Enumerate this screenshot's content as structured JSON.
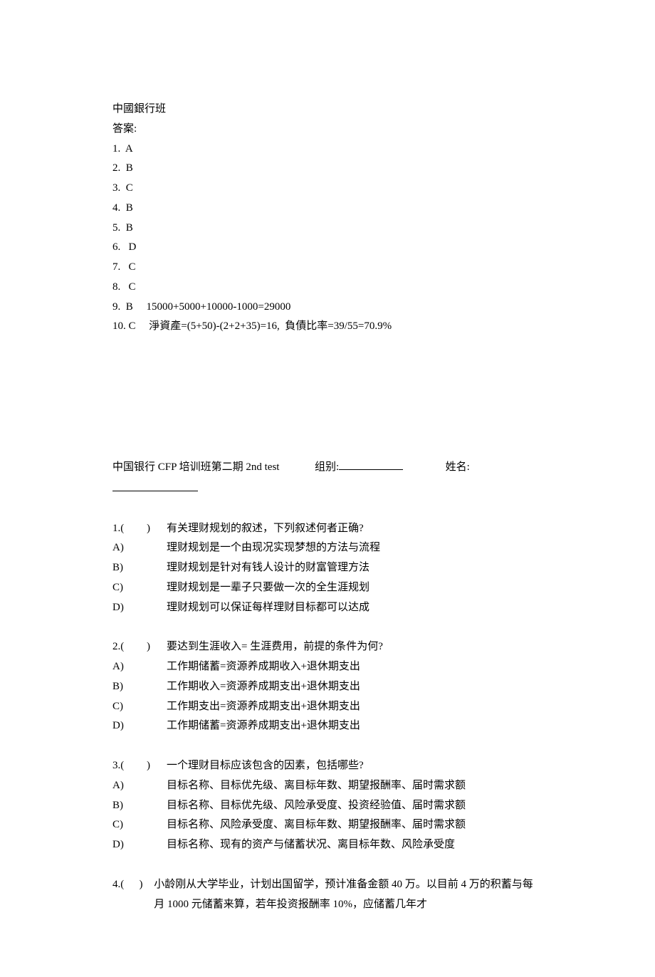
{
  "answer_section": {
    "title": "中國銀行班",
    "label": "答案:",
    "items": [
      {
        "num": "1.",
        "letter": "A",
        "note": ""
      },
      {
        "num": "2.",
        "letter": "B",
        "note": ""
      },
      {
        "num": "3.",
        "letter": "C",
        "note": ""
      },
      {
        "num": "4.",
        "letter": "B",
        "note": ""
      },
      {
        "num": "5.",
        "letter": "B",
        "note": ""
      },
      {
        "num": "6.",
        "letter": " D",
        "note": ""
      },
      {
        "num": "7.",
        "letter": " C",
        "note": ""
      },
      {
        "num": "8.",
        "letter": " C",
        "note": ""
      },
      {
        "num": "9.",
        "letter": "B",
        "note": "15000+5000+10000-1000=29000"
      },
      {
        "num": "10.",
        "letter": "C",
        "note": "淨資產=(5+50)-(2+2+35)=16,  負債比率=39/55=70.9%"
      }
    ]
  },
  "test_header": {
    "title": "中国银行 CFP 培训班第二期 2nd test",
    "group_label": "组别:",
    "name_label": "姓名:"
  },
  "questions": [
    {
      "num": "1.(",
      "paren": ")",
      "text": "有关理财规划的叙述，下列叙述何者正确?",
      "options": [
        {
          "label": "A)",
          "text": "理财规划是一个由现况实现梦想的方法与流程"
        },
        {
          "label": "B)",
          "text": "理财规划是针对有钱人设计的财富管理方法"
        },
        {
          "label": "C)",
          "text": "理财规划是一辈子只要做一次的全生涯规划"
        },
        {
          "label": "D)",
          "text": "理财规划可以保证每样理财目标都可以达成"
        }
      ]
    },
    {
      "num": "2.(",
      "paren": ")",
      "text": "要达到生涯收入= 生涯费用，前提的条件为何?",
      "options": [
        {
          "label": "A)",
          "text": "工作期储蓄=资源养成期收入+退休期支出"
        },
        {
          "label": "B)",
          "text": "工作期收入=资源养成期支出+退休期支出"
        },
        {
          "label": "C)",
          "text": "工作期支出=资源养成期支出+退休期支出"
        },
        {
          "label": "D)",
          "text": "工作期储蓄=资源养成期支出+退休期支出"
        }
      ]
    },
    {
      "num": "3.(",
      "paren": ")",
      "text": "一个理财目标应该包含的因素，包括哪些?",
      "options": [
        {
          "label": "A)",
          "text": "目标名称、目标优先级、离目标年数、期望报酬率、届时需求额"
        },
        {
          "label": "B)",
          "text": "目标名称、目标优先级、风险承受度、投资经验值、届时需求额"
        },
        {
          "label": "C)",
          "text": "目标名称、风险承受度、离目标年数、期望报酬率、届时需求额"
        },
        {
          "label": "D)",
          "text": "目标名称、现有的资产与储蓄状况、离目标年数、风险承受度"
        }
      ]
    },
    {
      "num": "4.(",
      "paren": ")",
      "text": "小龄刚从大学毕业，计划出国留学，预计准备金额 40 万。以目前 4 万的积蓄与每月 1000 元储蓄来算，若年投资报酬率 10%，应储蓄几年才",
      "options": []
    }
  ]
}
